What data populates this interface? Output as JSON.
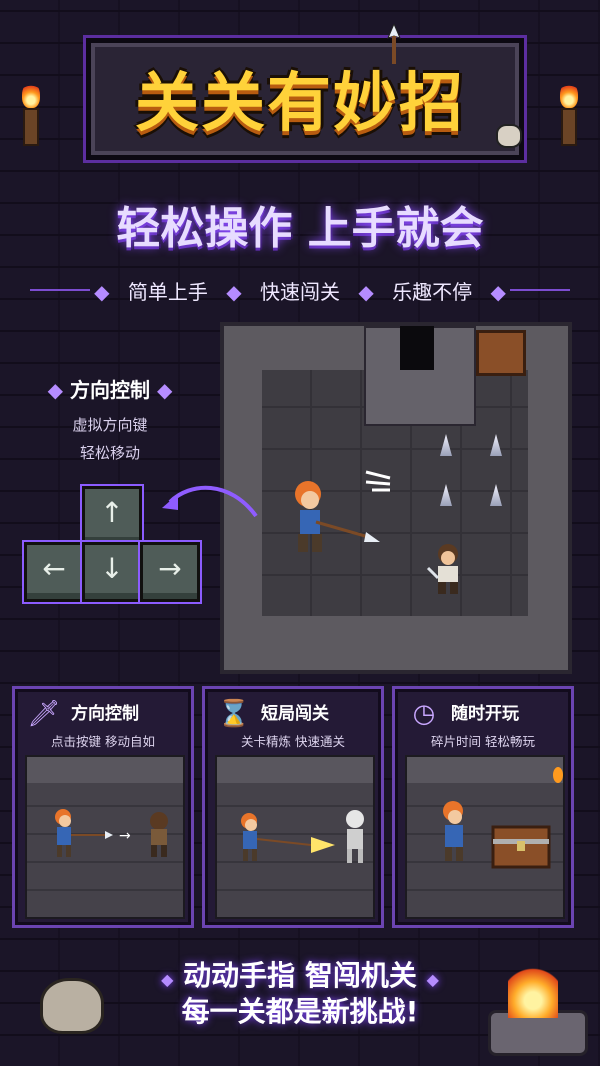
{
  "title": "关关有妙招",
  "subtitle": "轻松操作 上手就会",
  "tags": [
    "简单上手",
    "快速闯关",
    "乐趣不停"
  ],
  "control": {
    "title": "方向控制",
    "desc1": "虚拟方向键",
    "desc2": "轻松移动",
    "keys": {
      "up": "↑",
      "left": "←",
      "down": "↓",
      "right": "→"
    }
  },
  "cards": [
    {
      "title": "方向控制",
      "desc": "点击按键 移动自如",
      "icon": "sword-icon"
    },
    {
      "title": "短局闯关",
      "desc": "关卡精炼 快速通关",
      "icon": "hourglass-icon"
    },
    {
      "title": "随时开玩",
      "desc": "碎片时间 轻松畅玩",
      "icon": "clock-icon"
    }
  ],
  "footer": {
    "line1": "动动手指 智闯机关",
    "line2": "每一关都是新挑战!"
  },
  "colors": {
    "accent": "#8b4cff",
    "gold": "#ffd23a",
    "card_border": "#6b44b2"
  }
}
